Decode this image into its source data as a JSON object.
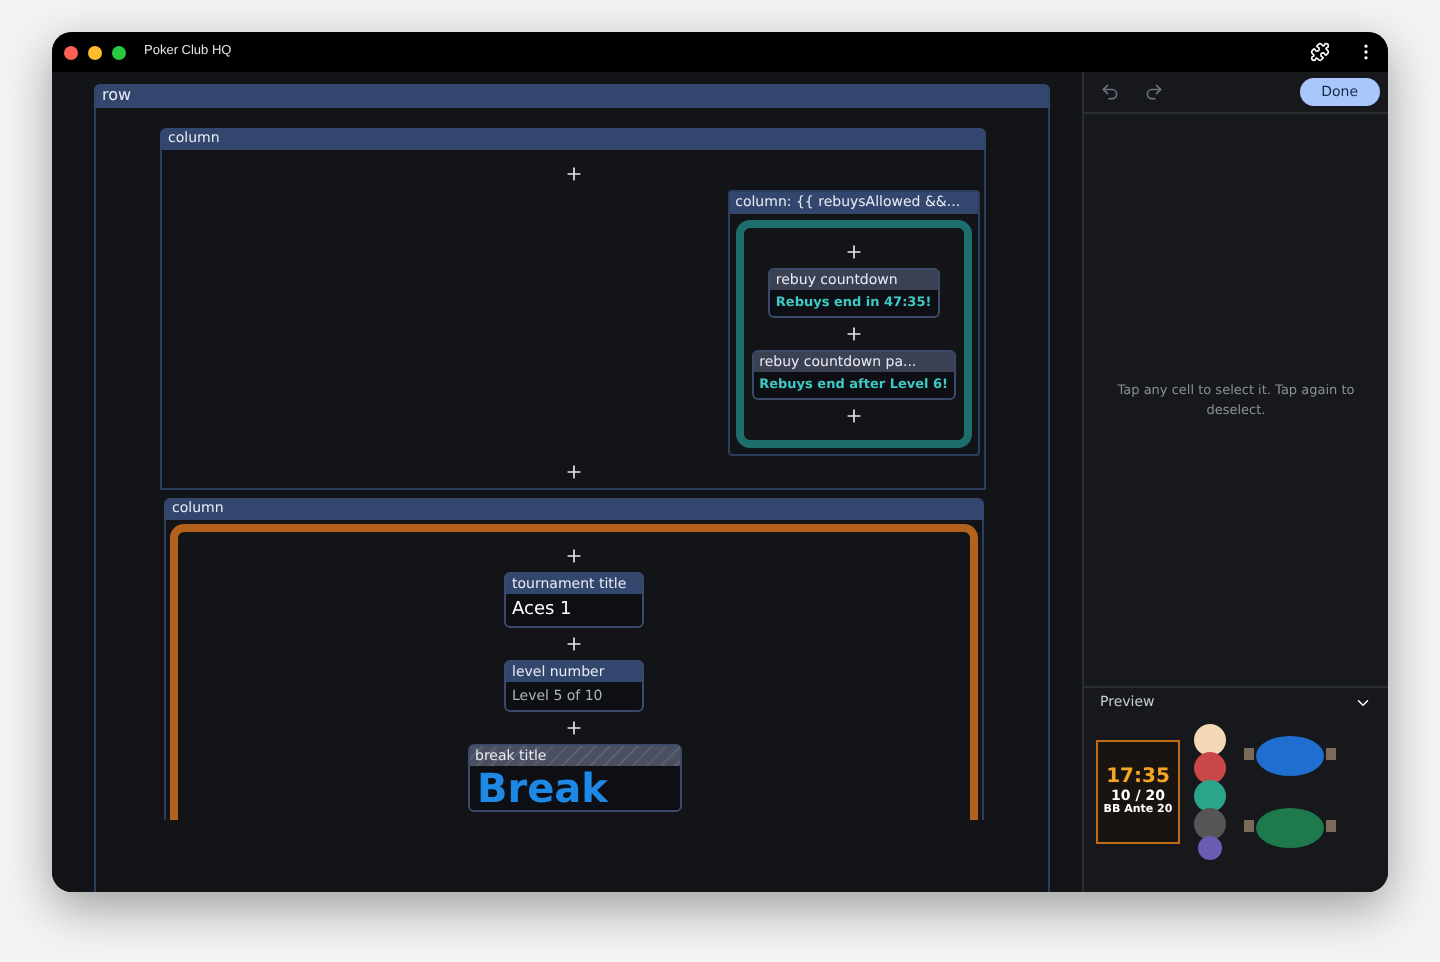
{
  "window": {
    "title": "Poker Club HQ"
  },
  "canvas": {
    "row_label": "row",
    "columns": [
      {
        "label": "column",
        "kind": "plain",
        "items": [
          {
            "kind": "add"
          },
          {
            "kind": "group",
            "label": "column: {{ rebuysAllowed &&...",
            "items": [
              {
                "kind": "add"
              },
              {
                "kind": "status",
                "label": "rebuy countdown",
                "value": "Rebuys end in 47:35!"
              },
              {
                "kind": "add"
              },
              {
                "kind": "status",
                "label": "rebuy countdown pa...",
                "value": "Rebuys end after Level 6!"
              },
              {
                "kind": "add"
              }
            ]
          },
          {
            "kind": "add"
          }
        ]
      },
      {
        "label": "column",
        "kind": "framed",
        "items": [
          {
            "kind": "add"
          },
          {
            "kind": "heading",
            "label": "tournament title",
            "value": "Aces 1"
          },
          {
            "kind": "add"
          },
          {
            "kind": "caption",
            "label": "level number",
            "value": "Level 5 of 10"
          },
          {
            "kind": "add"
          },
          {
            "kind": "banner",
            "label": "break title",
            "value": "Break"
          }
        ]
      }
    ]
  },
  "side_panel": {
    "done_button": "Done",
    "message": "Tap any cell to select it. Tap again to deselect.",
    "preview": {
      "title": "Preview",
      "expanded": true,
      "clock": "17:35",
      "blinds": "10 / 20",
      "ante": "BB Ante 20"
    }
  }
}
